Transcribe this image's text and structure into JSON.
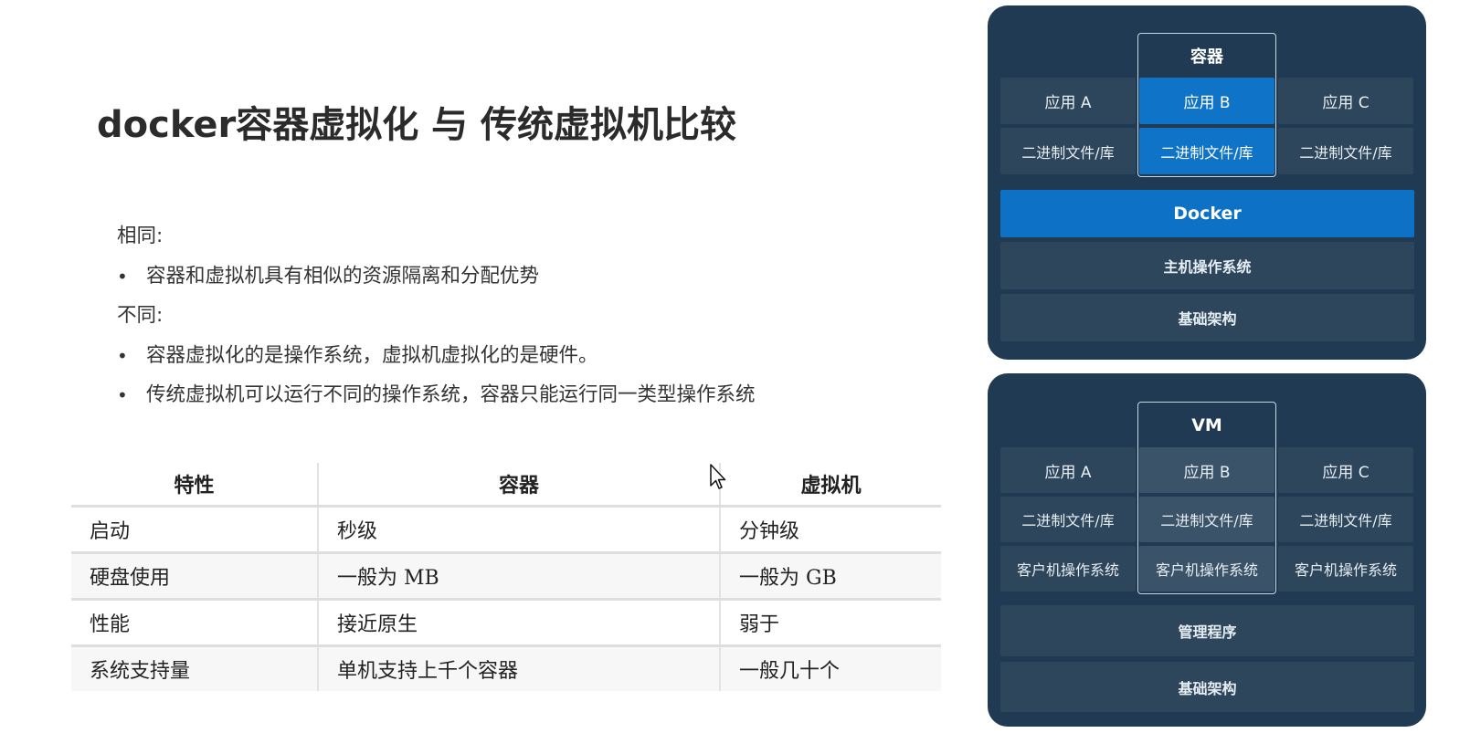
{
  "title": "docker容器虚拟化 与 传统虚拟机比较",
  "content": {
    "same_heading": "相同:",
    "same_items": [
      "容器和虚拟机具有相似的资源隔离和分配优势"
    ],
    "diff_heading": "不同:",
    "diff_items": [
      "容器虚拟化的是操作系统，虚拟机虚拟化的是硬件。",
      "传统虚拟机可以运行不同的操作系统，容器只能运行同一类型操作系统"
    ],
    "bullet": "•"
  },
  "table": {
    "headers": [
      "特性",
      "容器",
      "虚拟机"
    ],
    "rows": [
      [
        "启动",
        "秒级",
        "分钟级"
      ],
      [
        "硬盘使用",
        "一般为 MB",
        "一般为 GB"
      ],
      [
        "性能",
        "接近原生",
        "弱于"
      ],
      [
        "系统支持量",
        "单机支持上千个容器",
        "一般几十个"
      ]
    ]
  },
  "container_diagram": {
    "frame_label": "容器",
    "apps": [
      "应用 A",
      "应用 B",
      "应用 C"
    ],
    "bins": [
      "二进制文件/库",
      "二进制文件/库",
      "二进制文件/库"
    ],
    "layers": [
      "Docker",
      "主机操作系统",
      "基础架构"
    ],
    "colors": {
      "panel": "#1f3a52",
      "box": "#2d465c",
      "highlight": "#0f74c7"
    }
  },
  "vm_diagram": {
    "frame_label": "VM",
    "apps": [
      "应用 A",
      "应用 B",
      "应用 C"
    ],
    "bins": [
      "二进制文件/库",
      "二进制文件/库",
      "二进制文件/库"
    ],
    "guest_os": [
      "客户机操作系统",
      "客户机操作系统",
      "客户机操作系统"
    ],
    "layers": [
      "管理程序",
      "基础架构"
    ]
  },
  "cursor_icon": "pointer-cursor-icon"
}
